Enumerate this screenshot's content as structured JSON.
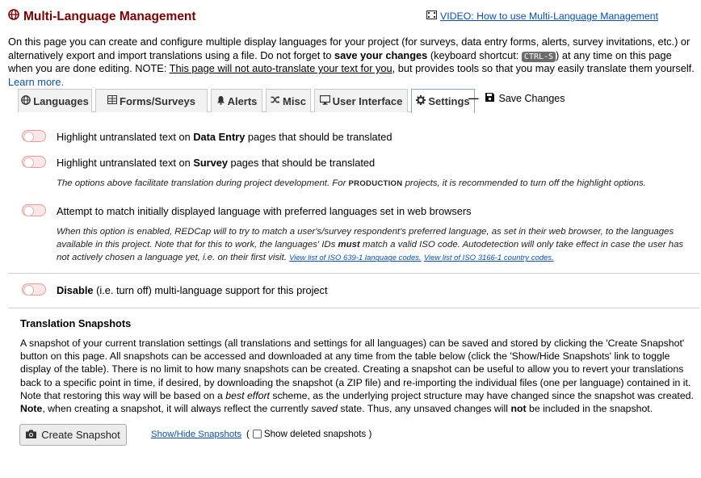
{
  "header": {
    "title": "Multi-Language Management",
    "title_icon": "globe-icon",
    "video_link": "VIDEO: How to use Multi-Language Management",
    "video_icon": "film-icon"
  },
  "intro": {
    "part1": "On this page you can create and configure multiple display languages for your project (for surveys, data entry forms, alerts, survey invitations, etc.) or alternatively export and import translations using a file. Do not forget to ",
    "save_bold": "save your changes",
    "part2": " (keyboard shortcut: ",
    "shortcut": "CTRL-S",
    "part3": ") at any time on this page when you are done editing. NOTE: ",
    "note_link": "This page will not auto-translate your text for you",
    "part4": ", but provides tools so that you may easily translate them yourself. ",
    "learn_more": "Learn more."
  },
  "tabs": [
    {
      "label": "Languages",
      "icon": "globe-icon"
    },
    {
      "label": "Forms/Surveys",
      "icon": "table-icon"
    },
    {
      "label": "Alerts",
      "icon": "bell-icon"
    },
    {
      "label": "Misc",
      "icon": "shuffle-icon"
    },
    {
      "label": "User Interface",
      "icon": "desktop-icon"
    },
    {
      "label": "Settings",
      "icon": "gear-icon",
      "active": true
    }
  ],
  "save_changes": {
    "label": "Save Changes",
    "icon": "floppy-icon"
  },
  "settings": {
    "opt1": {
      "pre": "Highlight untranslated text on ",
      "bold": "Data Entry",
      "post": " pages that should be translated"
    },
    "opt2": {
      "pre": "Highlight untranslated text on ",
      "bold": "Survey",
      "post": " pages that should be translated"
    },
    "note_a": {
      "pre": "The options above facilitate translation during project development. For ",
      "sc": "PRODUCTION",
      "post": " projects, it is recommended to turn off the highlight options."
    },
    "opt3": {
      "label": "Attempt to match initially displayed language with preferred languages set in web browsers"
    },
    "note_b": {
      "pre": "When this option is enabled, REDCap will to try to match a user's/survey respondent's preferred language, as set in their web browser, to the languages available in this project. Note that for this to work, the languages' IDs ",
      "bold": "must",
      "post": " match a valid ISO code. Autodetection will only take effect in case the user has not actively chosen a language yet, i.e. on their first visit. ",
      "link1": "View list of ISO 639-1 language codes.",
      "link2": "View list of ISO 3166-1 country codes."
    },
    "opt4": {
      "bold": "Disable",
      "post": " (i.e. turn off) multi-language support for this project"
    }
  },
  "snapshots": {
    "title": "Translation Snapshots",
    "desc1": "A snapshot of your current translation settings (all translations and settings for all languages) can be saved and stored by clicking the 'Create Snapshot' button on this page. All snapshots can be accessed and downloaded at any time from the table below (click the 'Show/Hide Snapshots' link to toggle display of the table). There is no limit to how many snapshots can be created. Creating a snapshot can be useful to allow you to revert your translations back to a specific point in time, if desired, by downloading the snapshot (a ZIP file) and re-importing the individual files (one per language) contained in it. Note that restoring this way will be based on a ",
    "best_effort": "best effort",
    "desc2": " scheme, as the underlying project structure may have changed since the snapshot was created. ",
    "note_bold": "Note",
    "desc3": ", when creating a snapshot, it will always reflect the currently ",
    "saved": "saved",
    "desc4": " state. Thus, any unsaved changes will ",
    "not": "not",
    "desc5": " be included in the snapshot.",
    "create_button": "Create Snapshot",
    "create_icon": "camera-icon",
    "show_hide": "Show/Hide Snapshots",
    "deleted_label": "Show deleted snapshots"
  },
  "colors": {
    "title": "#800000",
    "link": "#0a4fb5",
    "toggle_off": "#fbe7e7"
  }
}
